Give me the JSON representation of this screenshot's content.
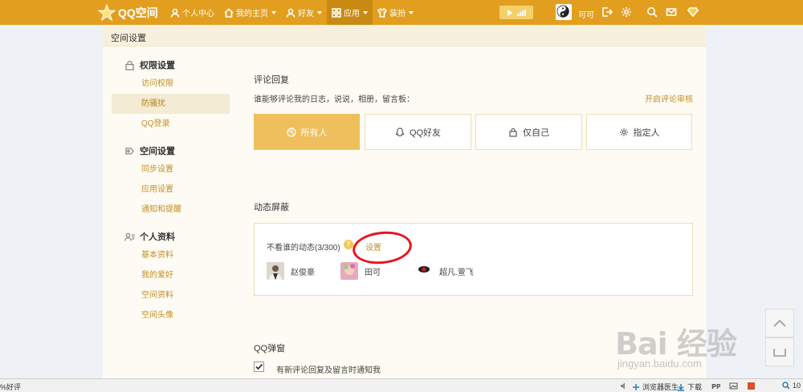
{
  "topbar": {
    "logo": "QQ空间",
    "nav": [
      {
        "label": "个人中心",
        "icon": "user-icon"
      },
      {
        "label": "我的主页",
        "icon": "home-icon"
      },
      {
        "label": "好友",
        "icon": "friend-icon"
      },
      {
        "label": "应用",
        "icon": "grid-icon"
      },
      {
        "label": "装扮",
        "icon": "shirt-icon"
      }
    ],
    "user": "可可",
    "accent": "#e29f1f"
  },
  "page_title": "空间设置",
  "sidebar": {
    "groups": [
      {
        "title": "权限设置",
        "icon": "lock-icon",
        "items": [
          "访问权限",
          "防骚扰",
          "QQ登录"
        ]
      },
      {
        "title": "空间设置",
        "icon": "shield-icon",
        "items": [
          "同步设置",
          "应用设置",
          "通知和提醒"
        ]
      },
      {
        "title": "个人资料",
        "icon": "profile-icon",
        "items": [
          "基本资料",
          "我的爱好",
          "空间资料",
          "空间头像"
        ]
      }
    ],
    "active_item": "防骚扰"
  },
  "comment": {
    "title": "评论回复",
    "subtitle": "谁能够评论我的日志，说说，相册，留言板：",
    "review_link": "开启评论审核",
    "options": [
      "所有人",
      "QQ好友",
      "仅自己",
      "指定人"
    ],
    "selected": "所有人"
  },
  "dynamic": {
    "title": "动态屏蔽",
    "not_see_label": "不看谁的动态(3/300)",
    "help": "?",
    "set_label": "设置",
    "friends": [
      "赵俊豪",
      "田可",
      "超凡.萱飞"
    ]
  },
  "popup": {
    "title": "QQ弹窗",
    "checkbox_label": "有新评论回复及留言时通知我",
    "checked": true
  },
  "watermark": {
    "main": "Bai 经验",
    "sub": "jingyan.baidu.com"
  },
  "statusbar": {
    "left": "%好评",
    "doctor": "浏览器医生",
    "download": "下载",
    "zoom": "10"
  }
}
